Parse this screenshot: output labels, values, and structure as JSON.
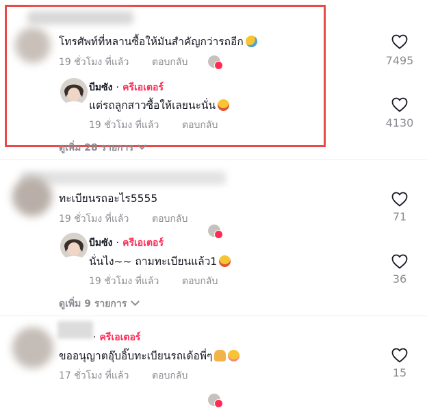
{
  "comments": [
    {
      "text": "โทรศัพท์ที่หลานซื้อให้มันสำคัญกว่ารถอีก",
      "time": "19 ชั่วโมง ที่แล้ว",
      "reply_label": "ตอบกลับ",
      "likes": "7495",
      "reply": {
        "author": "บีมซัง",
        "separator": "·",
        "badge": "ครีเอเตอร์",
        "text": "แต่รถลูกสาวซื้อให้เลยนะนั่น",
        "time": "19 ชั่วโมง ที่แล้ว",
        "reply_label": "ตอบกลับ",
        "likes": "4130"
      },
      "more": "ดูเพิ่ม 28 รายการ"
    },
    {
      "text": "ทะเบียนรถอะไร5555",
      "time": "19 ชั่วโมง ที่แล้ว",
      "reply_label": "ตอบกลับ",
      "likes": "71",
      "reply": {
        "author": "บีมซัง",
        "separator": "·",
        "badge": "ครีเอเตอร์",
        "text": "นั่นไง~~ ถามทะเบียนแล้ว1",
        "time": "19 ชั่วโมง ที่แล้ว",
        "reply_label": "ตอบกลับ",
        "likes": "36"
      },
      "more": "ดูเพิ่ม 9 รายการ"
    },
    {
      "separator": "·",
      "badge": "ครีเอเตอร์",
      "text": "ขออนุญาตอุ๊บอิ๊บทะเบียนรถเด้อพี่ๆ",
      "time": "17 ชั่วโมง ที่แล้ว",
      "reply_label": "ตอบกลับ",
      "likes": "15"
    }
  ],
  "colors": {
    "creator_badge": "#fe2c55",
    "highlight_border": "#e84a4a",
    "meta_text": "#8a8b91"
  },
  "icons": [
    "heart-outline-icon",
    "creator-avatar-icon",
    "chevron-down-icon",
    "emoji-sweat-smile",
    "emoji-laughing",
    "emoji-pray",
    "emoji-blush"
  ]
}
